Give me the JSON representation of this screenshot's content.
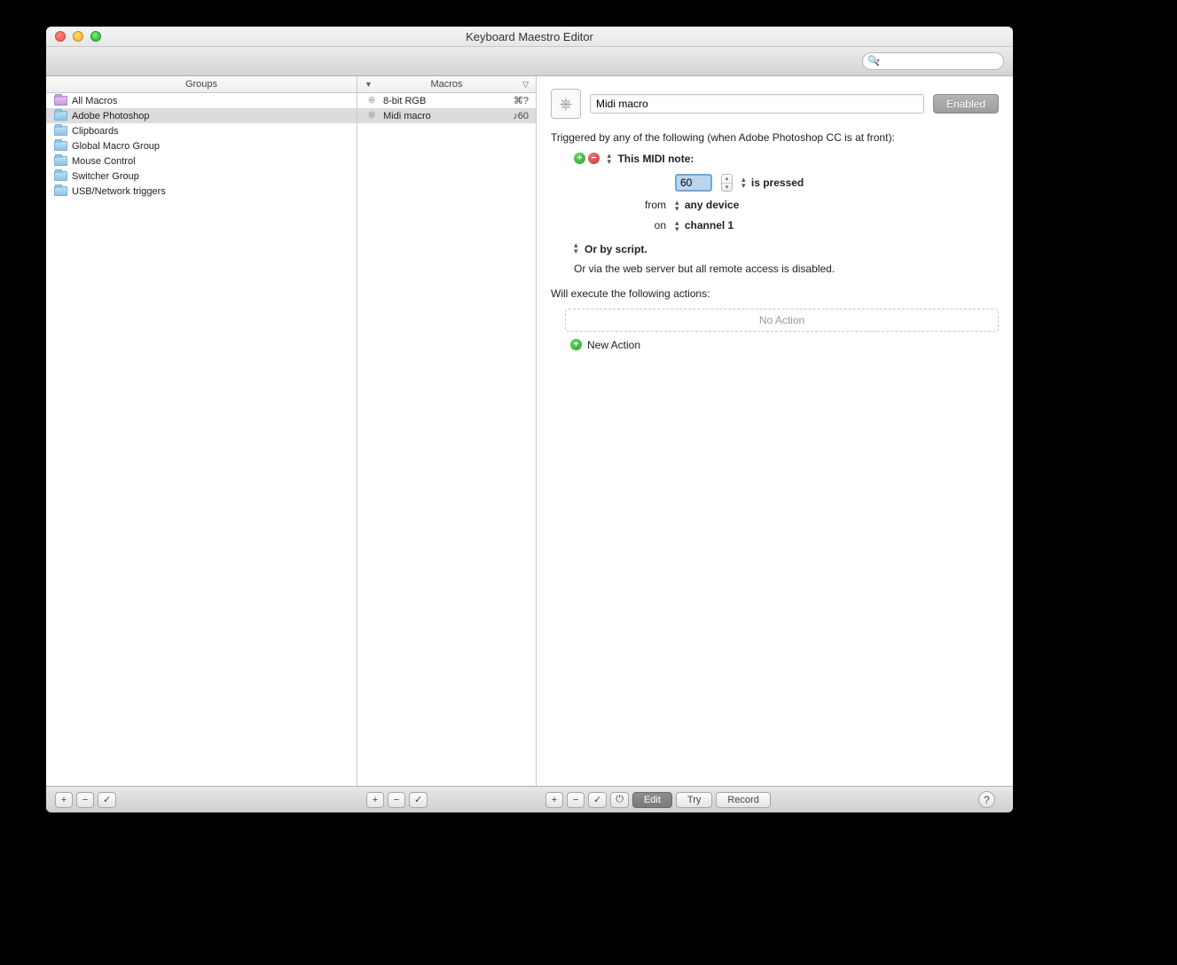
{
  "window": {
    "title": "Keyboard Maestro Editor"
  },
  "search": {
    "placeholder": ""
  },
  "groups": {
    "header": "Groups",
    "items": [
      {
        "label": "All Macros",
        "color": "purple"
      },
      {
        "label": "Adobe Photoshop",
        "selected": true
      },
      {
        "label": "Clipboards"
      },
      {
        "label": "Global Macro Group"
      },
      {
        "label": "Mouse Control"
      },
      {
        "label": "Switcher Group"
      },
      {
        "label": "USB/Network triggers"
      }
    ]
  },
  "macros": {
    "header": "Macros",
    "items": [
      {
        "label": "8-bit RGB",
        "shortcut": "⌘?"
      },
      {
        "label": "Midi macro",
        "shortcut": "♪60",
        "selected": true
      }
    ]
  },
  "detail": {
    "name": "Midi macro",
    "enabled_label": "Enabled",
    "trigger_intro": "Triggered by any of the following (when Adobe Photoshop CC is at front):",
    "trigger_type": "This MIDI note:",
    "note_value": "60",
    "note_condition": "is pressed",
    "from_label": "from",
    "from_value": "any device",
    "on_label": "on",
    "on_value": "channel 1",
    "or_script": "Or by script.",
    "web_server": "Or via the web server but all remote access is disabled.",
    "exec_label": "Will execute the following actions:",
    "no_action": "No Action",
    "new_action": "New Action"
  },
  "footer": {
    "edit": "Edit",
    "try": "Try",
    "record": "Record"
  }
}
